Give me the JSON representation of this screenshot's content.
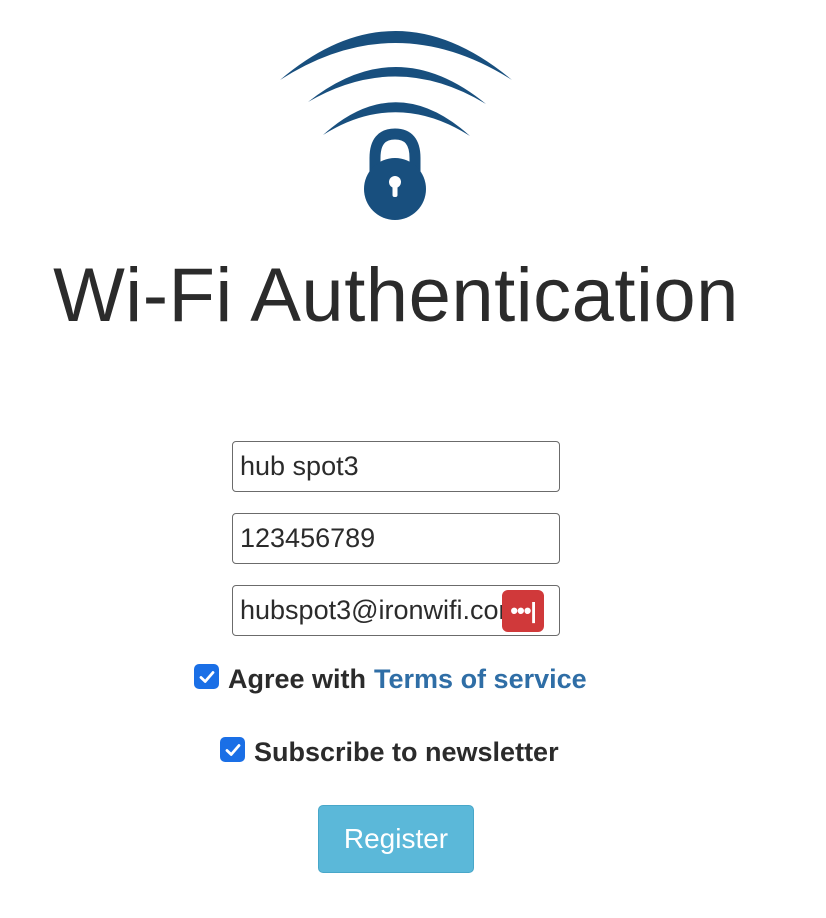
{
  "colors": {
    "logo": "#184f7e",
    "title": "#2b2b2b",
    "link": "#2f6ea6",
    "checkbox": "#1a6fe6",
    "register_button": "#5bb8d9",
    "password_manager_badge": "#d0393a"
  },
  "header": {
    "logo_icon": "wifi-lock-icon",
    "title": "Wi-Fi Authentication"
  },
  "form": {
    "username": {
      "value": "hub spot3"
    },
    "phone": {
      "value": "123456789"
    },
    "email": {
      "value": "hubspot3@ironwifi.com",
      "autofill_icon": "password-manager-icon"
    },
    "agree": {
      "checked": true,
      "label": "Agree with",
      "link_label": "Terms of service"
    },
    "newsletter": {
      "checked": true,
      "label": "Subscribe to newsletter"
    },
    "register_label": "Register"
  }
}
